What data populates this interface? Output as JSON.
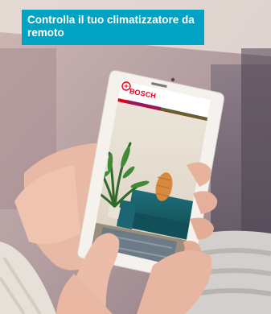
{
  "caption": {
    "text": "Controlla il tuo climatizzatore da remoto",
    "background": "#00a3c4",
    "color": "#ffffff"
  },
  "phone_screen": {
    "brand_name": "BOSCH",
    "brand_color": "#e2001a",
    "logo_icon": "bosch-armature-logo-icon"
  }
}
